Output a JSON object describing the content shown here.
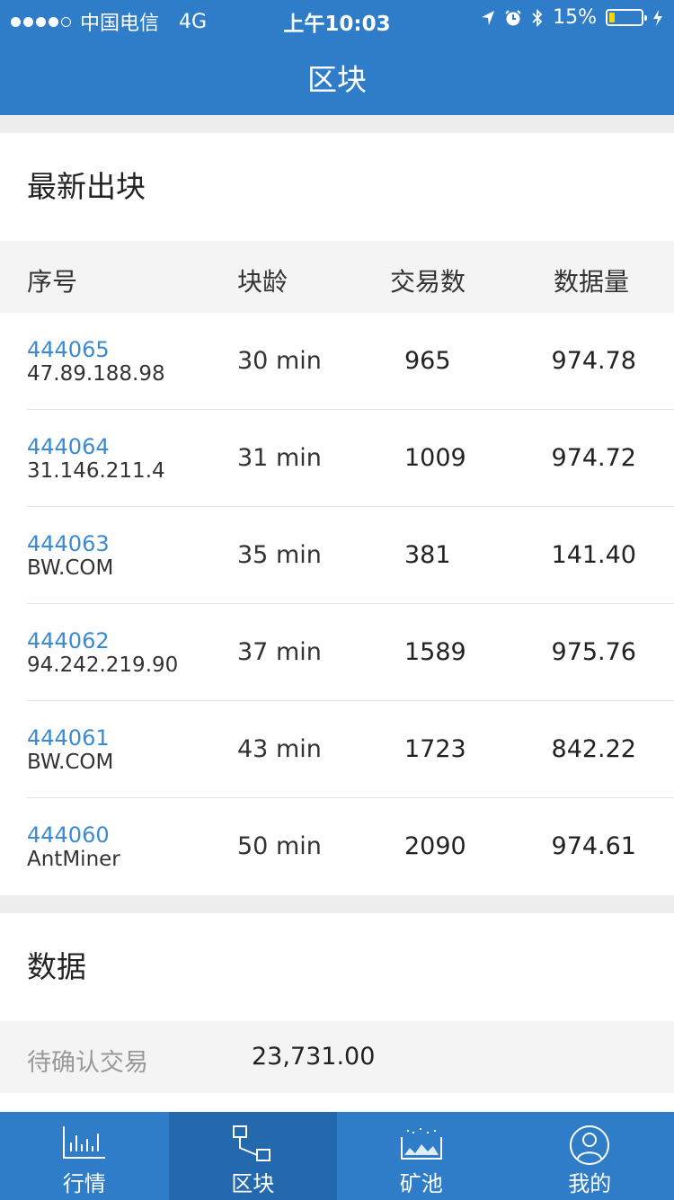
{
  "status_bar": {
    "carrier": "中国电信",
    "network": "4G",
    "time": "上午10:03",
    "battery": "15%",
    "battery_level": 0.15
  },
  "nav": {
    "title": "区块"
  },
  "latest_blocks": {
    "title": "最新出块",
    "columns": [
      "序号",
      "块龄",
      "交易数",
      "数据量"
    ],
    "rows": [
      {
        "height": "444065",
        "miner": "47.89.188.98",
        "age": "30 min",
        "tx": "965",
        "size": "974.78"
      },
      {
        "height": "444064",
        "miner": "31.146.211.4",
        "age": "31 min",
        "tx": "1009",
        "size": "974.72"
      },
      {
        "height": "444063",
        "miner": "BW.COM",
        "age": "35 min",
        "tx": "381",
        "size": "141.40"
      },
      {
        "height": "444062",
        "miner": "94.242.219.90",
        "age": "37 min",
        "tx": "1589",
        "size": "975.76"
      },
      {
        "height": "444061",
        "miner": "BW.COM",
        "age": "43 min",
        "tx": "1723",
        "size": "842.22"
      },
      {
        "height": "444060",
        "miner": "AntMiner",
        "age": "50 min",
        "tx": "2090",
        "size": "974.61"
      }
    ]
  },
  "data_section": {
    "title": "数据",
    "items": [
      {
        "label": "待确认交易",
        "value": "23,731.00"
      }
    ]
  },
  "tabs": [
    {
      "label": "行情",
      "icon": "chart-icon",
      "active": false
    },
    {
      "label": "区块",
      "icon": "block-icon",
      "active": true
    },
    {
      "label": "矿池",
      "icon": "pool-icon",
      "active": false
    },
    {
      "label": "我的",
      "icon": "user-icon",
      "active": false
    }
  ],
  "colors": {
    "primary": "#2f7dc8",
    "active_tab": "#2468ad",
    "link": "#3a8bd4"
  }
}
